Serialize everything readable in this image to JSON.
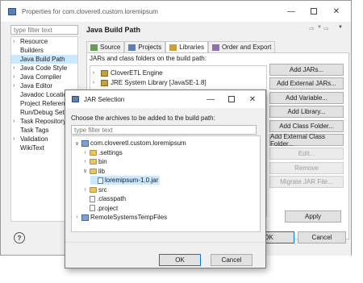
{
  "props_window": {
    "title": "Properties for com.cloveretl.custom.loremipsum",
    "filter_placeholder": "type filter text",
    "nav_items": [
      {
        "label": "Resource",
        "expandable": true
      },
      {
        "label": "Builders",
        "expandable": false
      },
      {
        "label": "Java Build Path",
        "expandable": false,
        "selected": true
      },
      {
        "label": "Java Code Style",
        "expandable": true
      },
      {
        "label": "Java Compiler",
        "expandable": true
      },
      {
        "label": "Java Editor",
        "expandable": true
      },
      {
        "label": "Javadoc Location",
        "expandable": false
      },
      {
        "label": "Project Reference",
        "expandable": false
      },
      {
        "label": "Run/Debug Setti",
        "expandable": false
      },
      {
        "label": "Task Repository",
        "expandable": true
      },
      {
        "label": "Task Tags",
        "expandable": false
      },
      {
        "label": "Validation",
        "expandable": true
      },
      {
        "label": "WikiText",
        "expandable": false
      }
    ],
    "page_title": "Java Build Path",
    "tabs": [
      "Source",
      "Projects",
      "Libraries",
      "Order and Export"
    ],
    "active_tab": "Libraries",
    "section_label": "JARs and class folders on the build path:",
    "libraries": [
      "CloverETL Engine",
      "JRE System Library [JavaSE-1.8]"
    ],
    "side_buttons": [
      {
        "label": "Add JARs...",
        "enabled": true
      },
      {
        "label": "Add External JARs...",
        "enabled": true
      },
      {
        "label": "Add Variable...",
        "enabled": true
      },
      {
        "label": "Add Library...",
        "enabled": true
      },
      {
        "label": "Add Class Folder...",
        "enabled": true
      },
      {
        "label": "Add External Class Folder...",
        "enabled": true
      },
      {
        "label": "Edit...",
        "enabled": false
      },
      {
        "label": "Remove",
        "enabled": false
      },
      {
        "label": "Migrate JAR File...",
        "enabled": false
      }
    ],
    "apply_label": "Apply",
    "ok_label": "OK",
    "cancel_label": "Cancel",
    "help_symbol": "?"
  },
  "jar_dialog": {
    "title": "JAR Selection",
    "prompt": "Choose the archives to be added to the build path:",
    "filter_placeholder": "type filter text",
    "tree": [
      {
        "label": "com.cloveretl.custom.loremipsum",
        "kind": "project",
        "toggle": "expanded"
      },
      {
        "label": ".settings",
        "kind": "folder",
        "toggle": "collapsed"
      },
      {
        "label": "bin",
        "kind": "folder",
        "toggle": "collapsed"
      },
      {
        "label": "lib",
        "kind": "folder",
        "toggle": "expanded"
      },
      {
        "label": "loremipsum-1.0.jar",
        "kind": "jar",
        "toggle": "none",
        "selected": true
      },
      {
        "label": "src",
        "kind": "folder",
        "toggle": "collapsed"
      },
      {
        "label": ".classpath",
        "kind": "file",
        "toggle": "none"
      },
      {
        "label": ".project",
        "kind": "file",
        "toggle": "none"
      },
      {
        "label": "RemoteSystemsTempFiles",
        "kind": "project",
        "toggle": "collapsed"
      }
    ],
    "ok_label": "OK",
    "cancel_label": "Cancel"
  },
  "colors": {
    "selection": "#cce8ff",
    "accent": "#0078d7",
    "window_bg": "#f0f0f0",
    "folder": "#e8c56b"
  },
  "icons": [
    "window-icon",
    "minimize-icon",
    "maximize-icon",
    "close-icon",
    "back-arrow-icon",
    "forward-arrow-icon",
    "menu-icon",
    "help-icon",
    "folder-icon",
    "jar-icon",
    "file-icon",
    "project-icon",
    "library-icon"
  ]
}
